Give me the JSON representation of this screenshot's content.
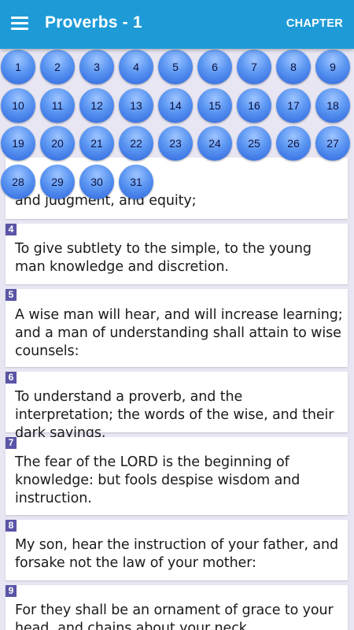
{
  "appbar": {
    "title": "Proverbs - 1",
    "chapter_label": "CHAPTER",
    "color": "#1e9bd7"
  },
  "chapters": [
    "1",
    "2",
    "3",
    "4",
    "5",
    "6",
    "7",
    "8",
    "9",
    "10",
    "11",
    "12",
    "13",
    "14",
    "15",
    "16",
    "17",
    "18",
    "19",
    "20",
    "21",
    "22",
    "23",
    "24",
    "25",
    "26",
    "27",
    "28",
    "29",
    "30",
    "31"
  ],
  "verses": [
    {
      "num": "",
      "text": "and judgment, and equity;"
    },
    {
      "num": "4",
      "text": "To give subtlety to the simple, to the young man knowledge and discretion."
    },
    {
      "num": "5",
      "text": "A wise man will hear, and will increase learning; and a man of understanding shall attain to wise counsels:"
    },
    {
      "num": "6",
      "text": "To understand a proverb, and the interpretation; the words of the wise, and their dark sayings."
    },
    {
      "num": "7",
      "text": "The fear of the LORD is the beginning of knowledge: but fools despise wisdom and instruction."
    },
    {
      "num": "8",
      "text": "My son, hear the instruction of your father, and forsake not the law of your mother:"
    },
    {
      "num": "9",
      "text": "For they shall be an ornament of grace to your head, and chains about your neck."
    }
  ],
  "colors": {
    "verse_badge": "#5a55a6",
    "chapter_button": "#4f8df0",
    "background": "#e8e6f2"
  }
}
